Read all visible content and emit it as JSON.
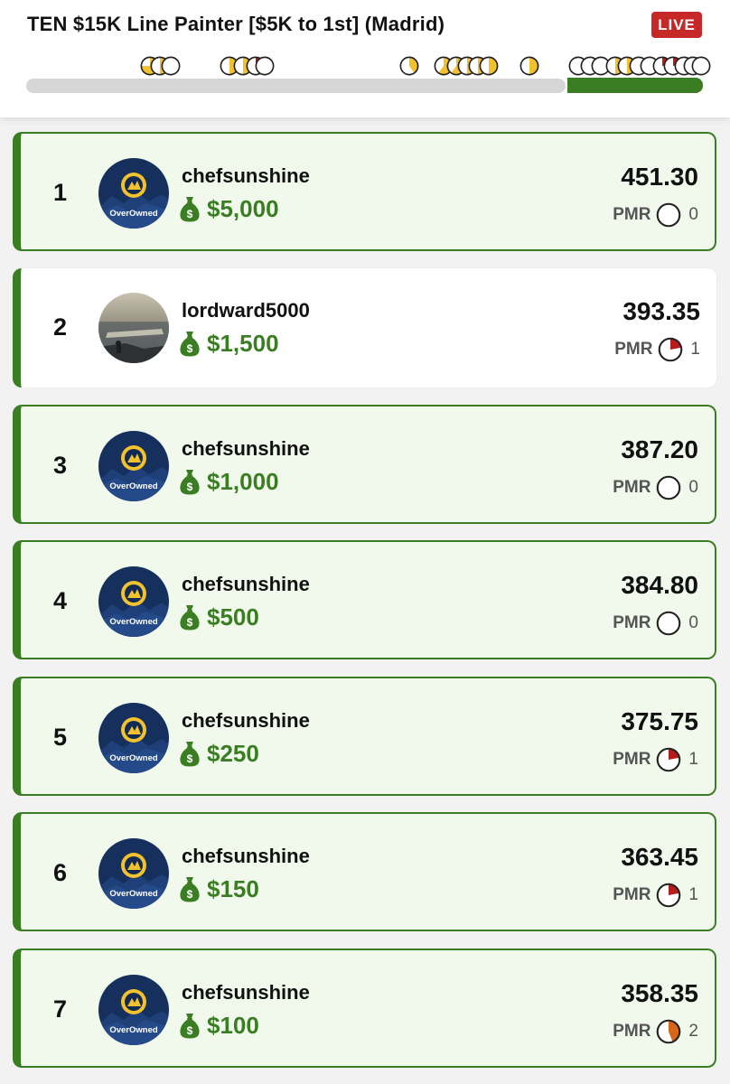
{
  "header": {
    "title": "TEN $15K Line Painter [$5K to 1st] (Madrid)",
    "live_badge": "LIVE",
    "colors": {
      "accent_green": "#3a7d22",
      "live_red": "#c62828",
      "track_gray": "#d6d6d6",
      "clock_yellow": "#f2c12e",
      "clock_red": "#b71c1c",
      "clock_orange": "#d8661a"
    },
    "progress_elapsed_fraction": 0.8
  },
  "entries": [
    {
      "rank": "1",
      "username": "chefsunshine",
      "prize": "$5,000",
      "score": "451.30",
      "pmr_label": "PMR",
      "pmr_value": "0",
      "pmr_fill": 0,
      "avatar": "overowned-logo",
      "avatar_text": "OverOwned",
      "highlight": true
    },
    {
      "rank": "2",
      "username": "lordward5000",
      "prize": "$1,500",
      "score": "393.35",
      "pmr_label": "PMR",
      "pmr_value": "1",
      "pmr_fill": 0.22,
      "avatar": "ocean-photo",
      "highlight": false
    },
    {
      "rank": "3",
      "username": "chefsunshine",
      "prize": "$1,000",
      "score": "387.20",
      "pmr_label": "PMR",
      "pmr_value": "0",
      "pmr_fill": 0,
      "avatar": "overowned-logo",
      "avatar_text": "OverOwned",
      "highlight": true
    },
    {
      "rank": "4",
      "username": "chefsunshine",
      "prize": "$500",
      "score": "384.80",
      "pmr_label": "PMR",
      "pmr_value": "0",
      "pmr_fill": 0,
      "avatar": "overowned-logo",
      "avatar_text": "OverOwned",
      "highlight": true
    },
    {
      "rank": "5",
      "username": "chefsunshine",
      "prize": "$250",
      "score": "375.75",
      "pmr_label": "PMR",
      "pmr_value": "1",
      "pmr_fill": 0.22,
      "avatar": "overowned-logo",
      "avatar_text": "OverOwned",
      "highlight": true
    },
    {
      "rank": "6",
      "username": "chefsunshine",
      "prize": "$150",
      "score": "363.45",
      "pmr_label": "PMR",
      "pmr_value": "1",
      "pmr_fill": 0.22,
      "avatar": "overowned-logo",
      "avatar_text": "OverOwned",
      "highlight": true
    },
    {
      "rank": "7",
      "username": "chefsunshine",
      "prize": "$100",
      "score": "358.35",
      "pmr_label": "PMR",
      "pmr_value": "2",
      "pmr_fill": 0.44,
      "avatar": "overowned-logo",
      "avatar_text": "OverOwned",
      "highlight": true
    }
  ]
}
